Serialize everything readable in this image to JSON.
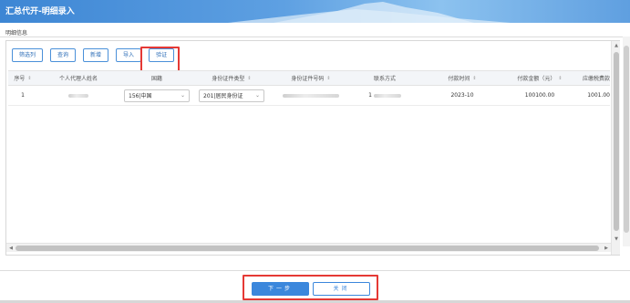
{
  "window": {
    "title": "汇总代开-明细录入"
  },
  "section": {
    "label": "明细信息"
  },
  "toolbar": {
    "buttons": [
      "筛选列",
      "查询",
      "新增",
      "导入",
      "验证"
    ]
  },
  "grid": {
    "columns": [
      "序号",
      "个人代理人姓名",
      "国籍",
      "身份证件类型",
      "身份证件号码",
      "联系方式",
      "付款时间",
      "付款金额（元）",
      "应缴税费款"
    ],
    "rows": [
      {
        "index": "1",
        "name": "",
        "nationality": "156|中国",
        "id_type": "201|居民身份证",
        "id_number": "",
        "contact": "1",
        "pay_time": "2023-10",
        "pay_amount": "100100.00",
        "tax": "1001.00"
      }
    ]
  },
  "footer": {
    "next_label": "下一步",
    "close_label": "关闭"
  },
  "colors": {
    "accent": "#3b87dc",
    "highlight": "#e53935"
  }
}
